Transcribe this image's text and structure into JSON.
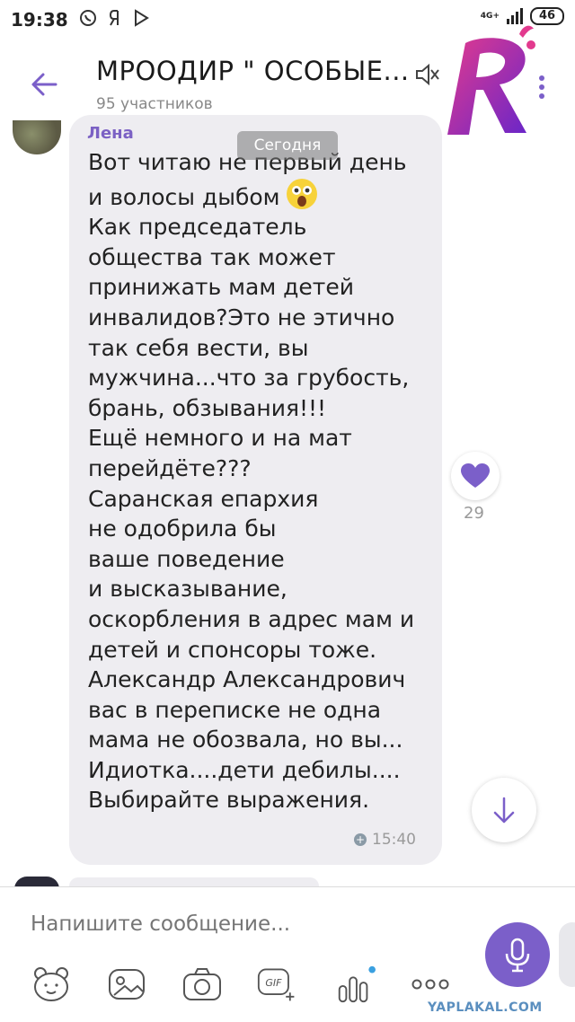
{
  "status_bar": {
    "time": "19:38",
    "network": "4G+",
    "battery": "46",
    "icons": [
      "viber-icon",
      "yandex-icon",
      "play-icon"
    ]
  },
  "header": {
    "title": "МРООДИР \" ОСОБЫЕ...",
    "subtitle": "95 участников",
    "icons": [
      "back-arrow-icon",
      "mute-icon",
      "more-icon"
    ]
  },
  "logo": {
    "letter": "R",
    "colors": {
      "primary": "#7a2fd0",
      "secondary": "#e23a8e"
    }
  },
  "date_divider": "Сегодня",
  "message": {
    "sender": "Лена",
    "lines_before_emoji": "Вот читаю не первый день\nи волосы дыбом",
    "emoji": "astonished-face-emoji",
    "lines_after_emoji": "Как председатель\nобщества так может\nпринижать мам детей\nинвалидов?Это не этично\nтак себя вести, вы\nмужчина...что за грубость,\nбрань, обзывания!!!\nЕщё немного и на мат\nперейдёте???\nСаранская епархия\nне одобрила бы\nваше  поведение\nи высказывание,\nоскорбления в адрес мам и\nдетей и спонсоры тоже.\nАлександр Александрович\nвас в  переписке не одна\nмама не обозвала, но вы...\nИдиотка....дети дебилы....\nВыбирайте выражения.",
    "time": "15:40",
    "likes": "29"
  },
  "composer": {
    "placeholder": "Напишите сообщение...",
    "tools": [
      "sticker-icon",
      "gallery-icon",
      "camera-icon",
      "gif-icon",
      "audio-icon",
      "more-options-icon"
    ],
    "gif_label": "GIF"
  },
  "watermark": "YAPLAKAL.COM",
  "colors": {
    "accent": "#7b5fc9",
    "bubble": "#eeedf1",
    "sender": "#7b61c4"
  }
}
